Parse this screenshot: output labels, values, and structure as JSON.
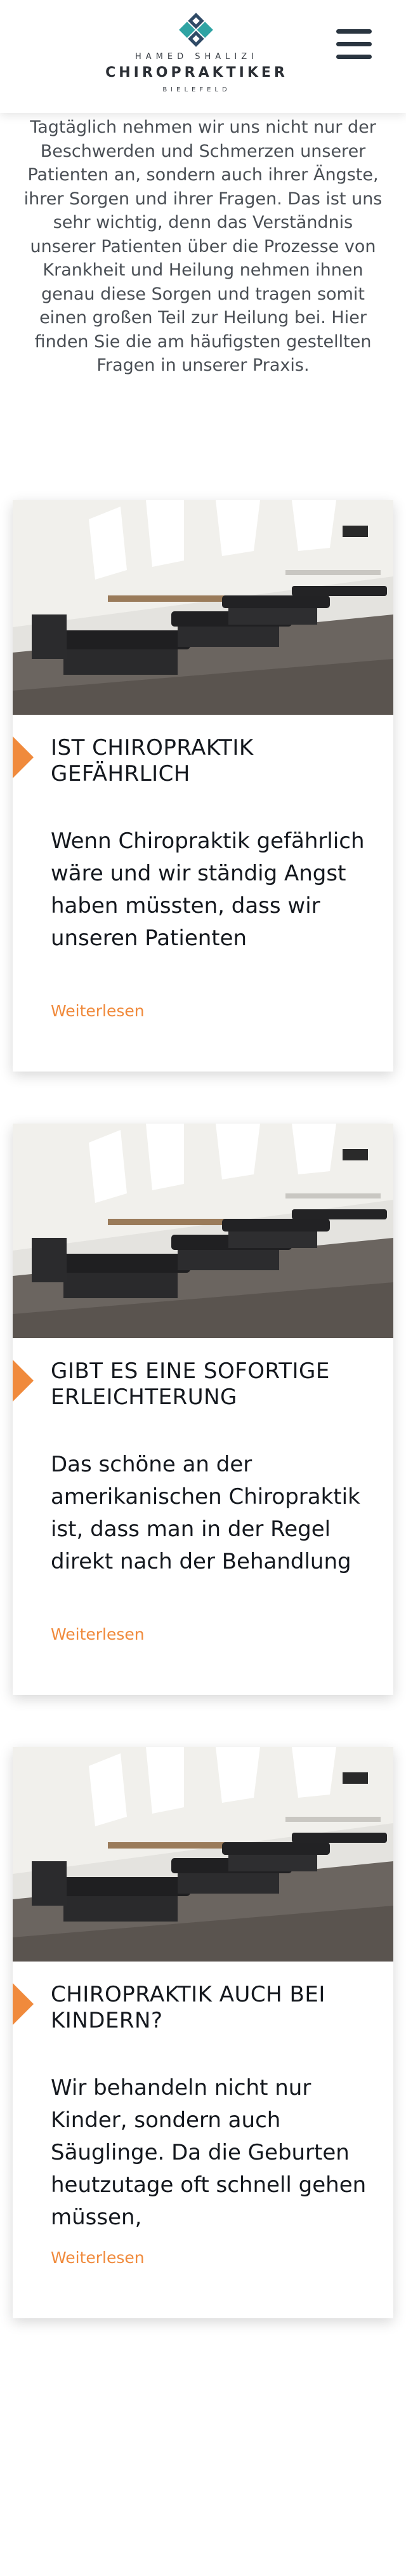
{
  "header": {
    "logo": {
      "name": "HAMED SHALIZI",
      "title": "CHIROPRAKTIKER",
      "city": "BIELEFELD"
    },
    "menu_icon": "hamburger-menu-icon"
  },
  "intro_text": "Tagtäglich nehmen wir uns nicht nur der Beschwerden und Schmerzen unserer Patienten an, sondern auch ihrer Ängste, ihrer Sorgen und ihrer Fragen. Das ist uns sehr wichtig, denn das Verständnis unserer Patienten über die Prozesse von Krankheit und Heilung nehmen ihnen genau diese Sorgen und tragen somit einen großen Teil zur Heilung bei. Hier finden Sie die am häufigsten gestellten Fragen in unserer Praxis.",
  "cards": [
    {
      "title": "Ist Chiropraktik gefährlich",
      "text": "Wenn Chiropraktik gefährlich wäre und wir ständig Angst haben müssten, dass wir unseren Patienten",
      "link": "Weiterlesen"
    },
    {
      "title": "Gibt es eine sofortige Erleichterung",
      "text": "Das schöne an der amerikanischen Chiropraktik ist, dass man in der Regel direkt nach der Behandlung",
      "link": "Weiterlesen"
    },
    {
      "title": "Chiropraktik auch bei Kindern?",
      "text": "Wir behandeln nicht nur Kinder, sondern auch Säuglinge. Da die Geburten heutzutage oft schnell gehen müssen,",
      "link": "Weiterlesen"
    }
  ],
  "colors": {
    "accent": "#f08a3c",
    "logo_blue": "#2f4a66",
    "logo_teal": "#2fa3a3",
    "menu": "#2a3540"
  }
}
